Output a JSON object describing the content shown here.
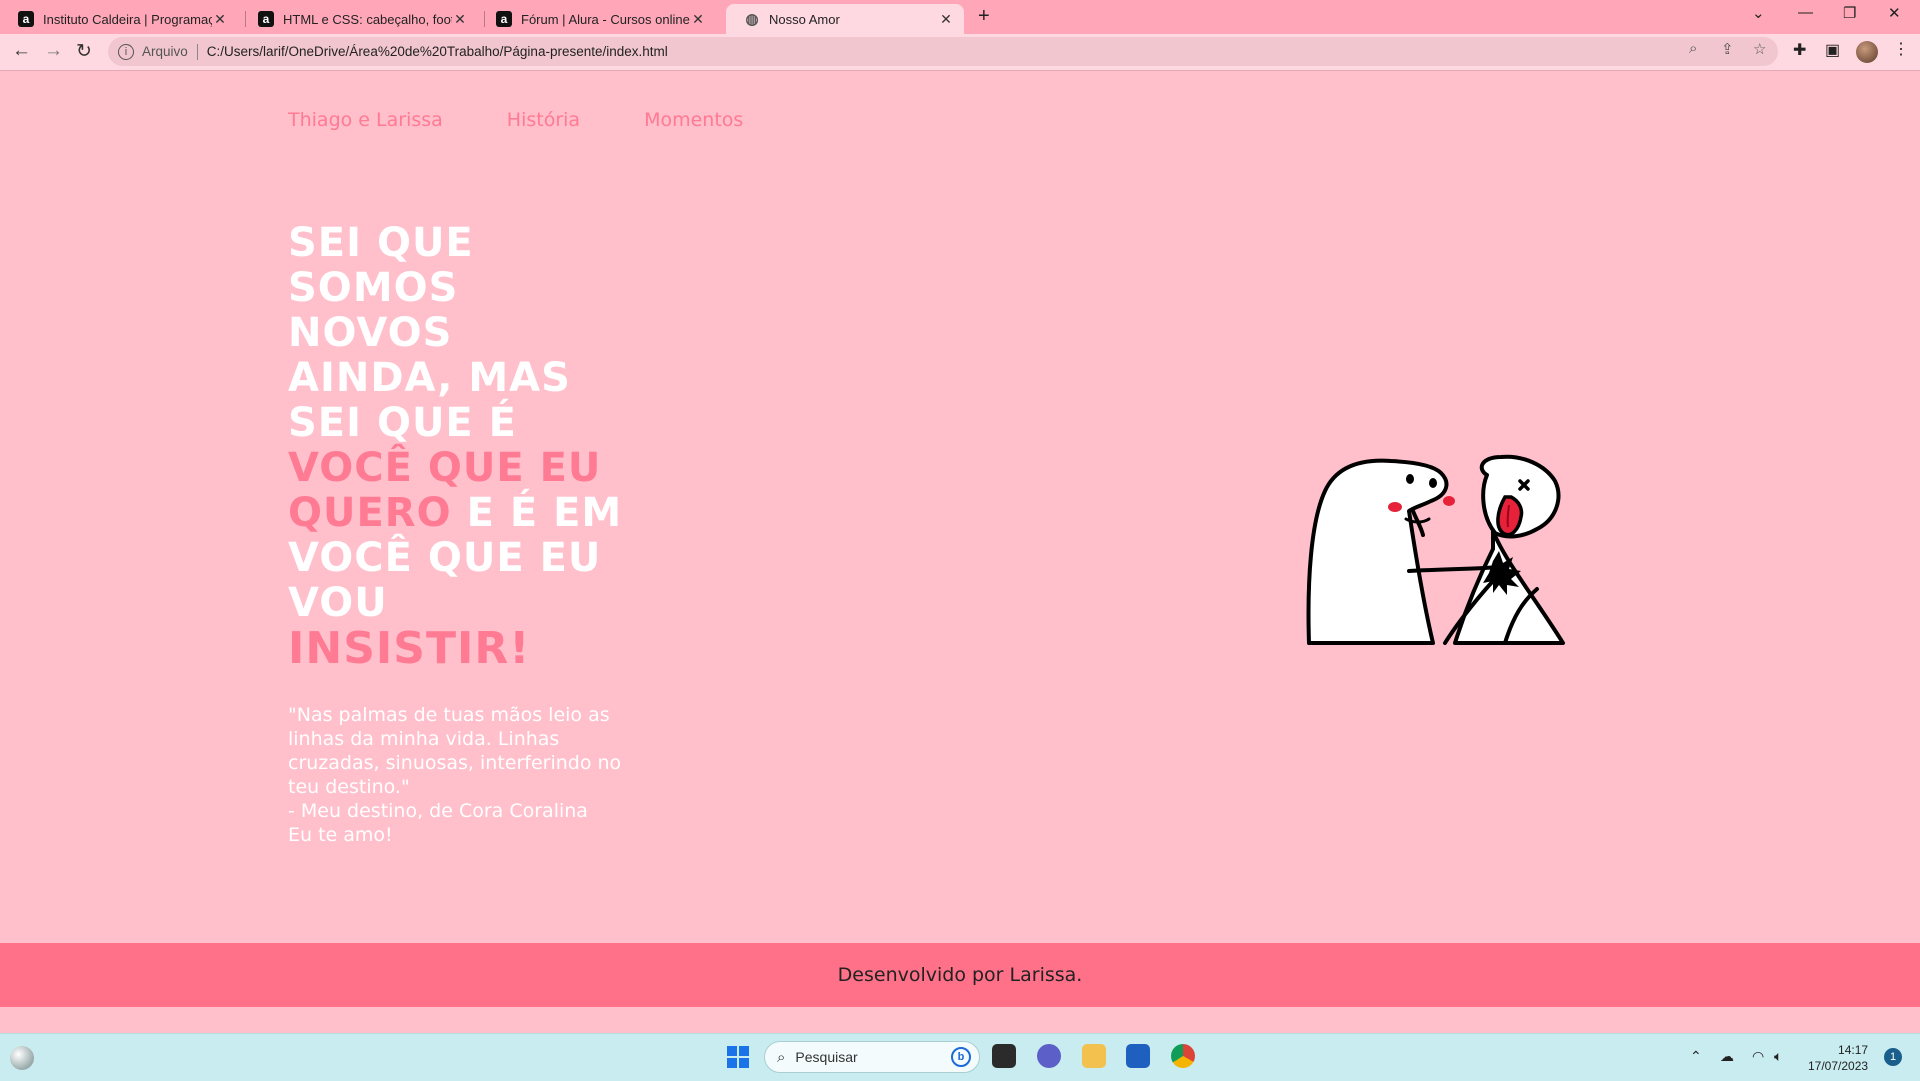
{
  "browser": {
    "tabs": [
      {
        "title": "Instituto Caldeira | Programação",
        "favicon": "a",
        "active": false
      },
      {
        "title": "HTML e CSS: cabeçalho, footer e",
        "favicon": "a",
        "active": false
      },
      {
        "title": "Fórum | Alura - Cursos online de",
        "favicon": "a",
        "active": false
      },
      {
        "title": "Nosso Amor",
        "favicon": "globe",
        "active": true
      }
    ],
    "address": {
      "protocol_label": "Arquivo",
      "url": "C:/Users/larif/OneDrive/Área%20de%20Trabalho/Página-presente/index.html"
    }
  },
  "page": {
    "nav": {
      "items": [
        "Thiago e Larissa",
        "História",
        "Momentos"
      ]
    },
    "headline": {
      "white_1": "Sei que somos novos ainda, mas sei que é",
      "pink_1": "você que eu quero",
      "white_2": "e é em você que eu vou",
      "pink_2": "insistir!"
    },
    "quote": {
      "line_1": "\"Nas palmas de tuas mãos leio as linhas da minha vida. Linhas cruzadas, sinuosas, interferindo no teu destino.\"",
      "line_2": "- Meu destino, de Cora Coralina",
      "line_3": "Eu te amo!"
    },
    "footer": {
      "text": "Desenvolvido por Larissa."
    }
  },
  "taskbar": {
    "search_placeholder": "Pesquisar",
    "time": "14:17",
    "date": "17/07/2023",
    "notification_count": "1"
  },
  "colors": {
    "page_background": "#ffbfcb",
    "accent_pink": "#ff7a93",
    "footer_background": "#ff7089",
    "tab_strip": "#ffa7b8"
  }
}
